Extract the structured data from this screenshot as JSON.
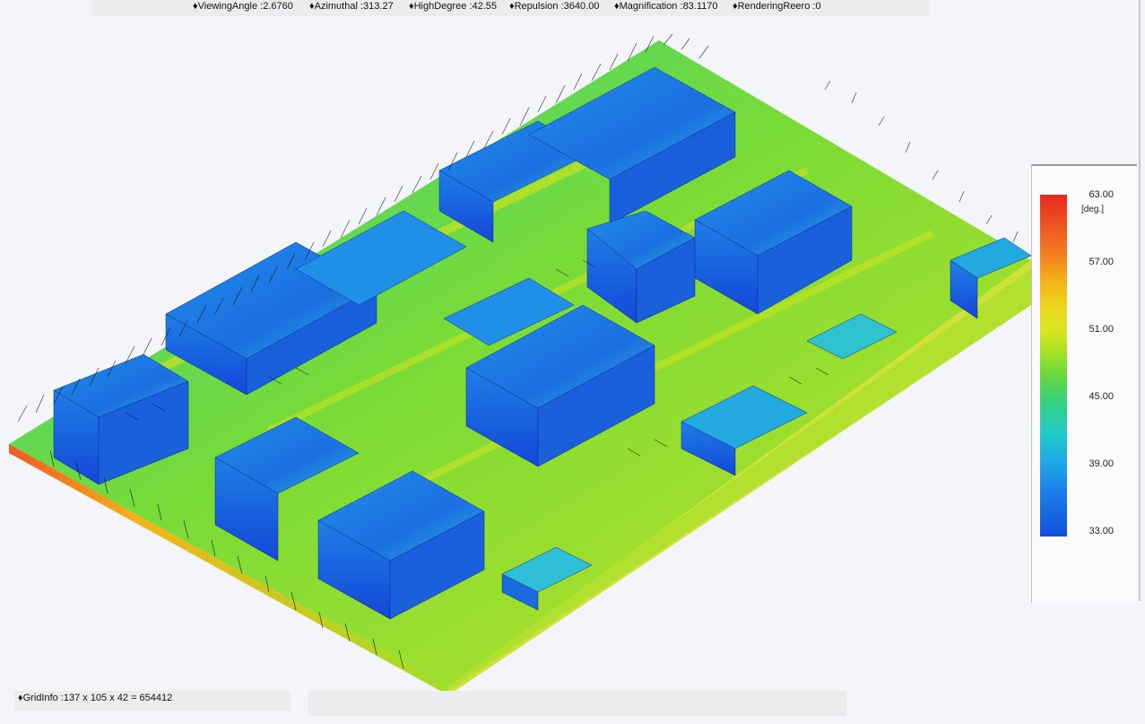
{
  "header": {
    "params": [
      {
        "label": "♦ViewingAngle",
        "value": "2.6760"
      },
      {
        "label": "♦Azimuthal",
        "value": "313.27"
      },
      {
        "label": "♦HighDegree",
        "value": "42.55"
      },
      {
        "label": "♦Repulsion",
        "value": "3640.00"
      },
      {
        "label": "♦Magnification",
        "value": "83.1170"
      },
      {
        "label": "♦RenderingReero",
        "value": "0"
      }
    ]
  },
  "legend": {
    "unit": "[deg.]",
    "ticks": [
      "63.00",
      "57.00",
      "51.00",
      "45.00",
      "39.00",
      "33.00"
    ],
    "colors": [
      "#e8281e",
      "#f2821e",
      "#ecd71e",
      "#5cd843",
      "#22c9c7",
      "#124fdb"
    ]
  },
  "footer": {
    "grid_info": "♦GridInfo :137 x 105 x 42 = 654412"
  },
  "scene": {
    "icon": "cfd-wind-simulation-visualization"
  }
}
